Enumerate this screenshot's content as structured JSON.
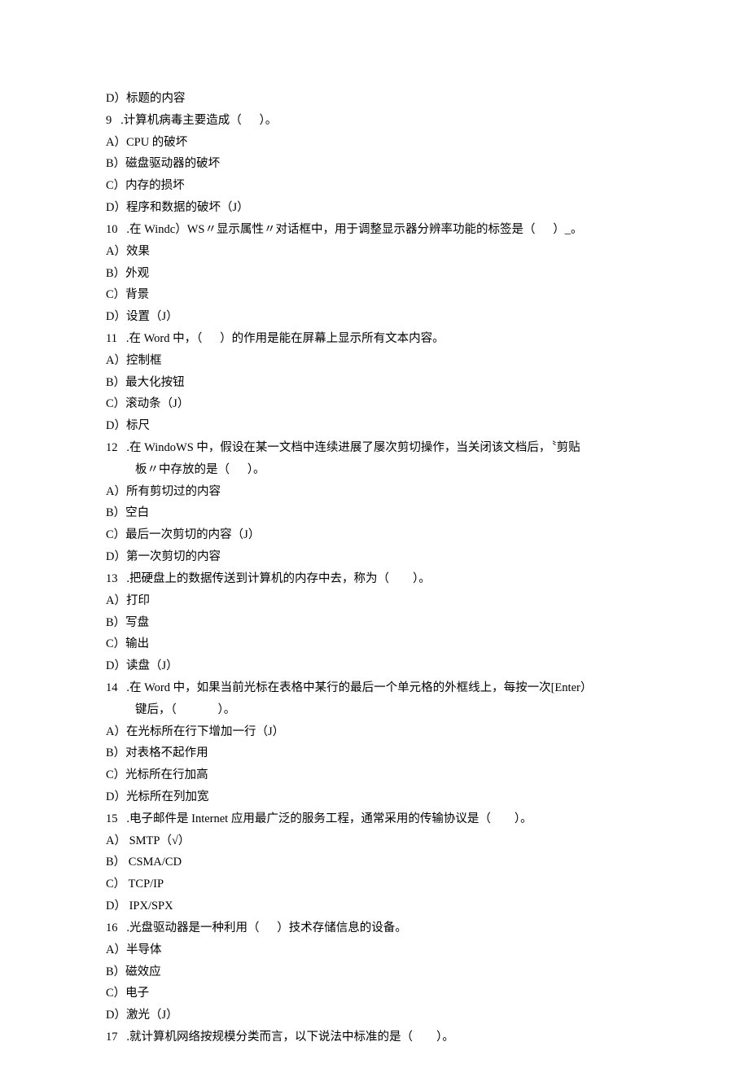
{
  "lines": [
    {
      "t": "D）标题的内容",
      "indent": 0
    },
    {
      "t": "9   .计算机病毒主要造成（      ）。",
      "indent": 0
    },
    {
      "t": "A）CPU 的破坏",
      "indent": 0
    },
    {
      "t": "B）磁盘驱动器的破坏",
      "indent": 0
    },
    {
      "t": "C）内存的损坏",
      "indent": 0
    },
    {
      "t": "D）程序和数据的破坏（J）",
      "indent": 0
    },
    {
      "t": "10   .在 Windc）WS〃显示属性〃对话框中，用于调整显示器分辨率功能的标签是（      ）_。",
      "indent": 0
    },
    {
      "t": "A）效果",
      "indent": 0
    },
    {
      "t": "B）外观",
      "indent": 0
    },
    {
      "t": "C）背景",
      "indent": 0
    },
    {
      "t": "D）设置（J）",
      "indent": 0
    },
    {
      "t": "11   .在 Word 中，（      ）的作用是能在屏幕上显示所有文本内容。",
      "indent": 0
    },
    {
      "t": "A）控制框",
      "indent": 0
    },
    {
      "t": "B）最大化按钮",
      "indent": 0
    },
    {
      "t": "C）滚动条（J）",
      "indent": 0
    },
    {
      "t": "D）标尺",
      "indent": 0
    },
    {
      "t": "12   .在 WindoWS 中，假设在某一文档中连续进展了屡次剪切操作，当关闭该文档后，〝剪贴",
      "indent": 0
    },
    {
      "t": "板〃中存放的是（      ）。",
      "indent": 1
    },
    {
      "t": "A）所有剪切过的内容",
      "indent": 0
    },
    {
      "t": "B）空白",
      "indent": 0
    },
    {
      "t": "C）最后一次剪切的内容（J）",
      "indent": 0
    },
    {
      "t": "D）第一次剪切的内容",
      "indent": 0
    },
    {
      "t": "13   .把硬盘上的数据传送到计算机的内存中去，称为（        ）。",
      "indent": 0
    },
    {
      "t": "A）打印",
      "indent": 0
    },
    {
      "t": "B）写盘",
      "indent": 0
    },
    {
      "t": "C）输出",
      "indent": 0
    },
    {
      "t": "D）读盘（J）",
      "indent": 0
    },
    {
      "t": "14   .在 Word 中，如果当前光标在表格中某行的最后一个单元格的外框线上，每按一次[Enter）",
      "indent": 0
    },
    {
      "t": "键后，（              ）。",
      "indent": 1
    },
    {
      "t": "A）在光标所在行下增加一行（J）",
      "indent": 0
    },
    {
      "t": "B）对表格不起作用",
      "indent": 0
    },
    {
      "t": "C）光标所在行加高",
      "indent": 0
    },
    {
      "t": "D）光标所在列加宽",
      "indent": 0
    },
    {
      "t": "15   .电子邮件是 Internet 应用最广泛的服务工程，通常采用的传输协议是（        ）。",
      "indent": 0
    },
    {
      "t": "A） SMTP（√）",
      "indent": 0
    },
    {
      "t": "B） CSMA/CD",
      "indent": 0
    },
    {
      "t": "C） TCP/IP",
      "indent": 0
    },
    {
      "t": "D） IPX/SPX",
      "indent": 0
    },
    {
      "t": "16   .光盘驱动器是一种利用（      ）技术存储信息的设备。",
      "indent": 0
    },
    {
      "t": "A）半导体",
      "indent": 0
    },
    {
      "t": "B）磁效应",
      "indent": 0
    },
    {
      "t": "C）电子",
      "indent": 0
    },
    {
      "t": "D）激光（J）",
      "indent": 0
    },
    {
      "t": "17   .就计算机网络按规模分类而言，以下说法中标准的是（        ）。",
      "indent": 0
    }
  ]
}
